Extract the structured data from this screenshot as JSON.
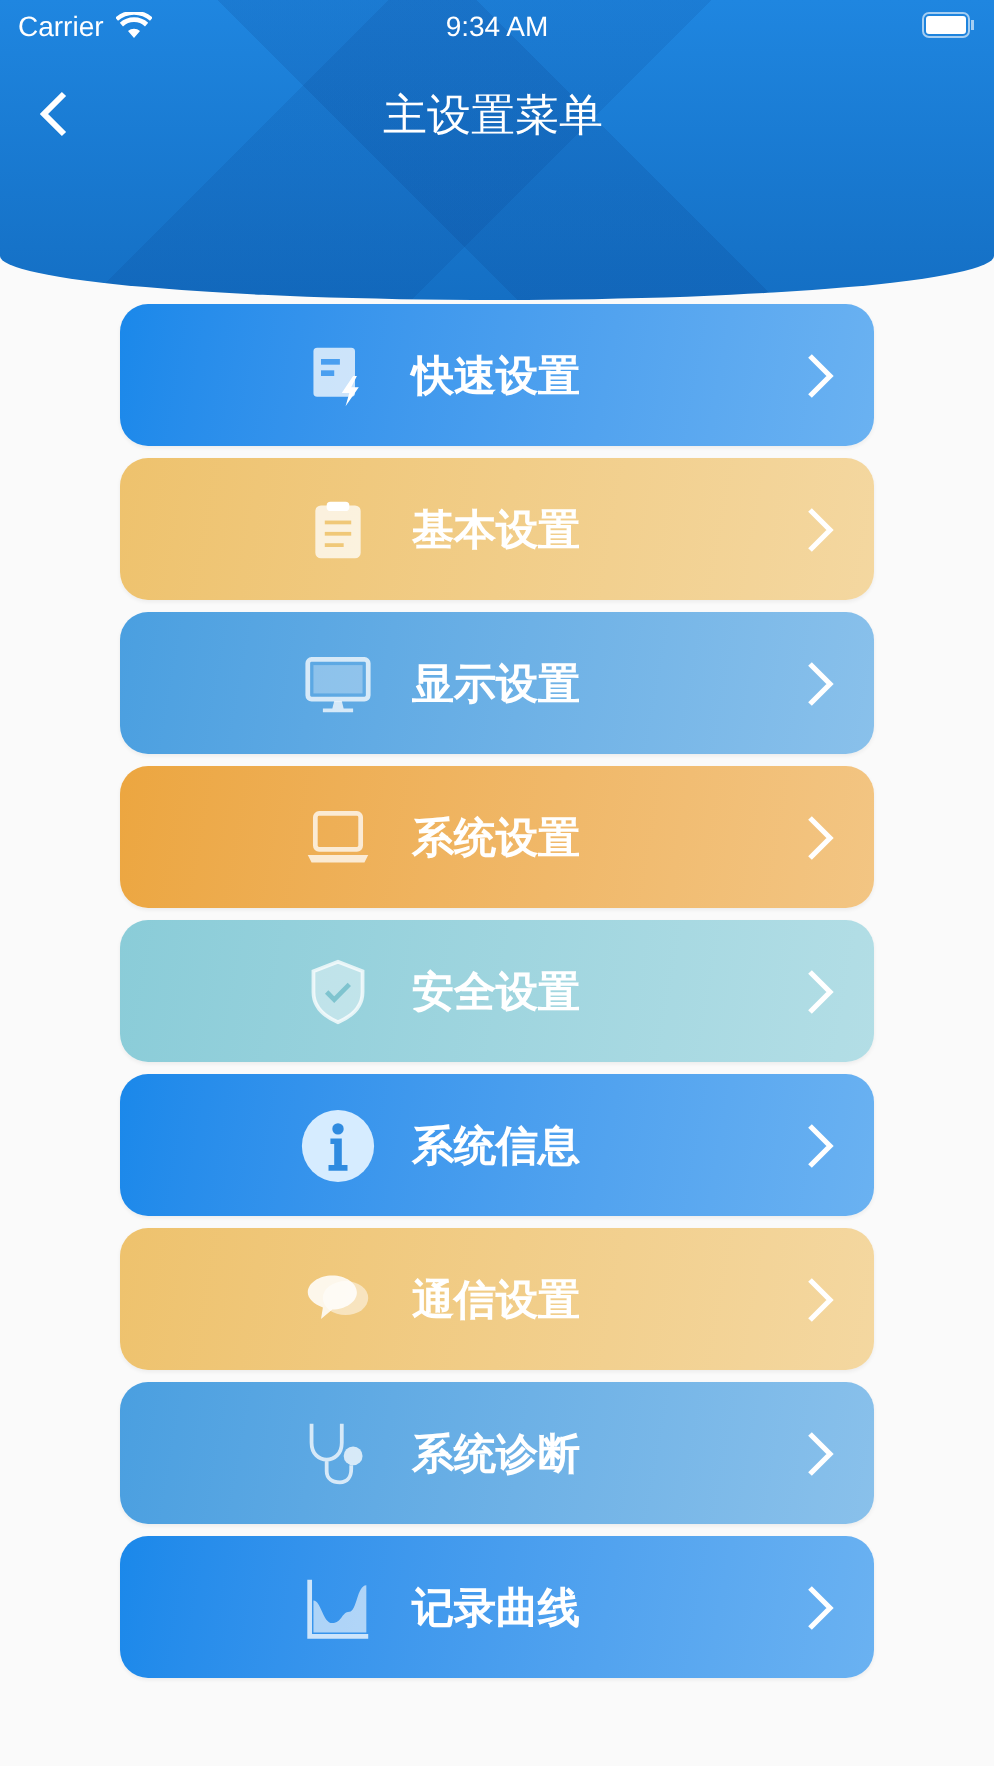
{
  "status_bar": {
    "carrier": "Carrier",
    "time": "9:34 AM"
  },
  "nav": {
    "title": "主设置菜单"
  },
  "menu": [
    {
      "label": "快速设置",
      "kind": "quick",
      "color": "#1a88ea"
    },
    {
      "label": "基本设置",
      "kind": "clipboard",
      "color": "#eec26d"
    },
    {
      "label": "显示设置",
      "kind": "monitor",
      "color": "#4a9fe0"
    },
    {
      "label": "系统设置",
      "kind": "laptop",
      "color": "#eca640"
    },
    {
      "label": "安全设置",
      "kind": "shield",
      "color": "#8accd8"
    },
    {
      "label": "系统信息",
      "kind": "info",
      "color": "#1a88ea"
    },
    {
      "label": "通信设置",
      "kind": "chat",
      "color": "#eec26d"
    },
    {
      "label": "系统诊断",
      "kind": "stethoscope",
      "color": "#4a9fe0"
    },
    {
      "label": "记录曲线",
      "kind": "chart",
      "color": "#1a88ea"
    }
  ]
}
